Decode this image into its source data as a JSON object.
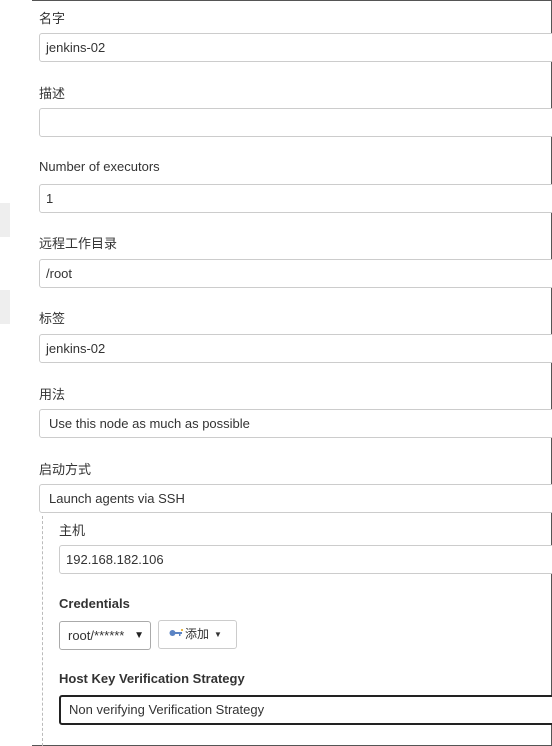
{
  "form": {
    "name_label": "名字",
    "name_value": "jenkins-02",
    "description_label": "描述",
    "description_value": "",
    "executors_label": "Number of executors",
    "executors_value": "1",
    "remote_dir_label": "远程工作目录",
    "remote_dir_value": "/root",
    "labels_label": "标签",
    "labels_value": "jenkins-02",
    "usage_label": "用法",
    "usage_value": "Use this node as much as possible",
    "launch_label": "启动方式",
    "launch_value": "Launch agents via SSH"
  },
  "ssh": {
    "host_label": "主机",
    "host_value": "192.168.182.106",
    "credentials_label": "Credentials",
    "credentials_value": "root/******",
    "add_button_label": "添加",
    "key_icon": "key-icon",
    "host_key_label": "Host Key Verification Strategy",
    "host_key_value": "Non verifying Verification Strategy"
  }
}
